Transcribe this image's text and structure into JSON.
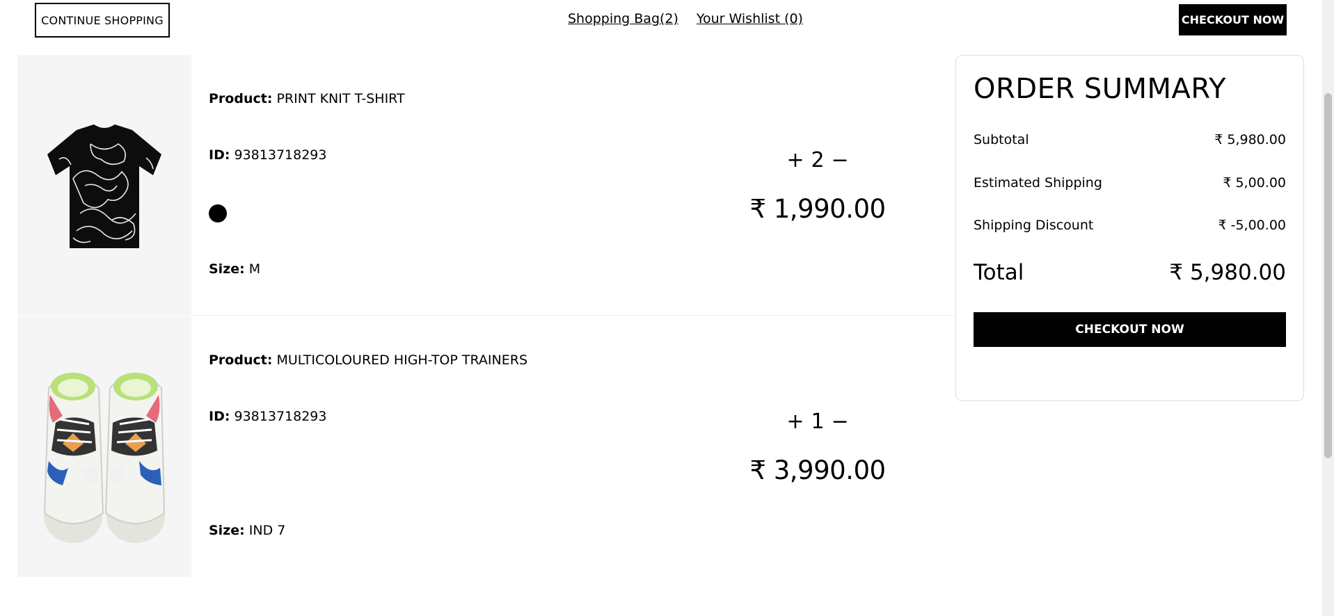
{
  "header": {
    "continue_label": "CONTINUE SHOPPING",
    "bag_link": "Shopping Bag(2)",
    "wishlist_link": "Your Wishlist (0)",
    "checkout_label": "CHECKOUT NOW"
  },
  "labels": {
    "product": "Product:",
    "id": "ID:",
    "size": "Size:",
    "plus": "+",
    "minus": "−"
  },
  "items": [
    {
      "name": "PRINT KNIT T-SHIRT",
      "id": "93813718293",
      "color": "#000000",
      "size": "M",
      "qty": "2",
      "price": "₹ 1,990.00"
    },
    {
      "name": "MULTICOLOURED HIGH-TOP TRAINERS",
      "id": "93813718293",
      "size": "IND 7",
      "qty": "1",
      "price": "₹ 3,990.00"
    }
  ],
  "summary": {
    "title": "ORDER SUMMARY",
    "subtotal_label": "Subtotal",
    "subtotal_value": "₹ 5,980.00",
    "shipping_label": "Estimated Shipping",
    "shipping_value": "₹ 5,00.00",
    "discount_label": "Shipping Discount",
    "discount_value": "₹ -5,00.00",
    "total_label": "Total",
    "total_value": "₹ 5,980.00",
    "checkout_label": "CHECKOUT NOW"
  }
}
